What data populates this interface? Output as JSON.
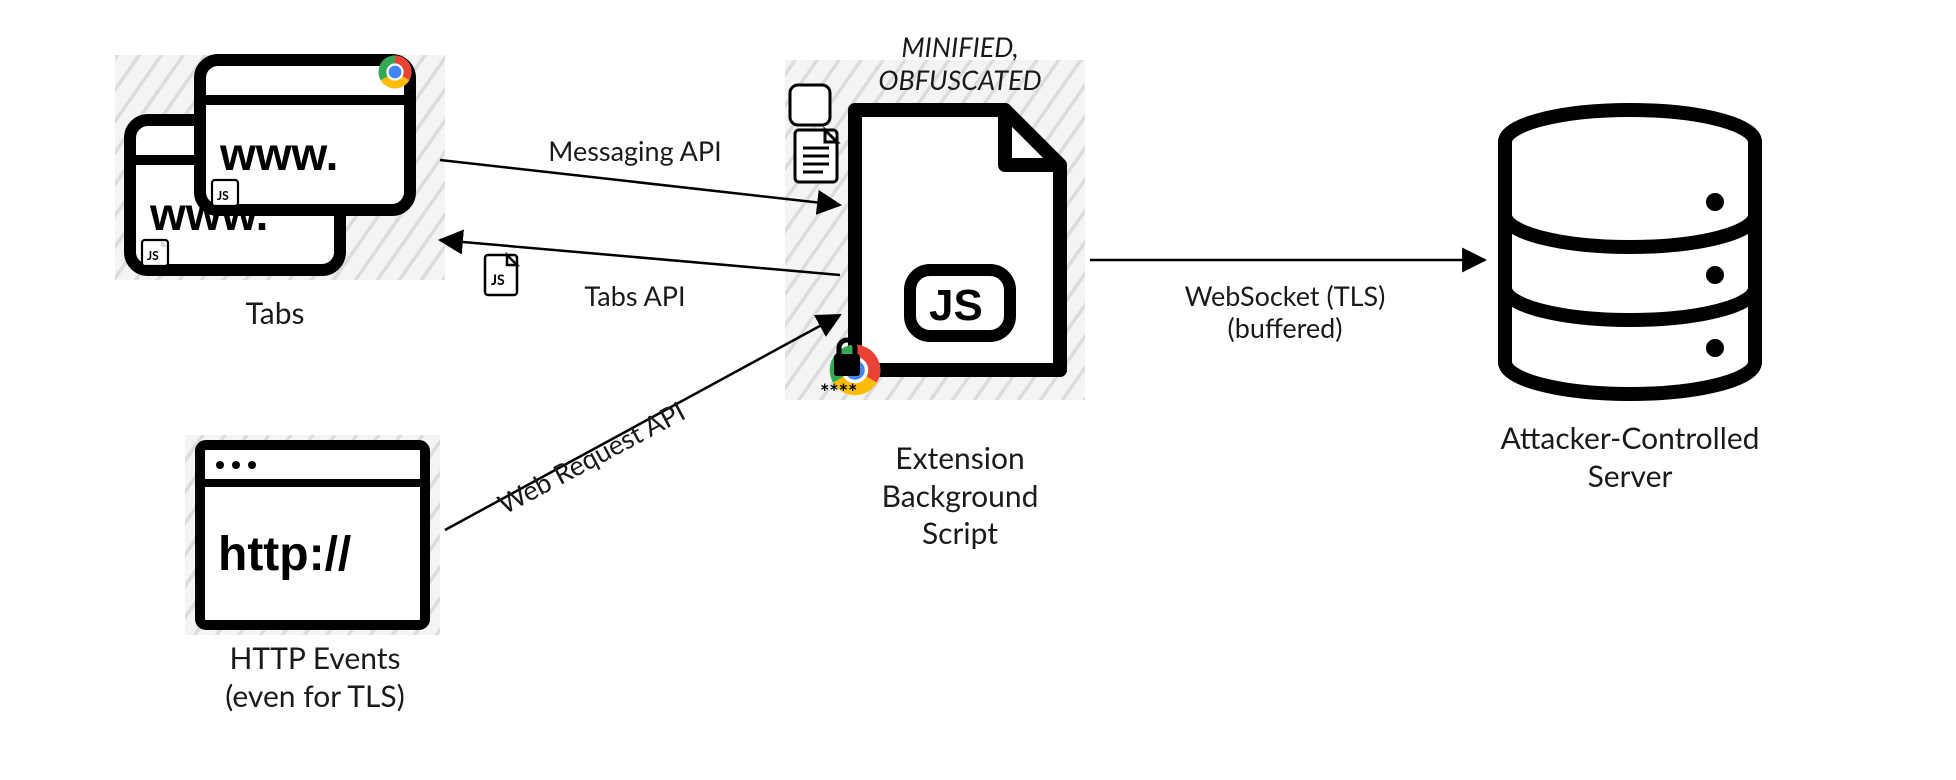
{
  "nodes": {
    "tabs": {
      "label": "Tabs",
      "windowText": "www."
    },
    "httpEvents": {
      "label": "HTTP Events\n(even for TLS)",
      "windowText": "http://"
    },
    "extScript": {
      "label": "Extension\nBackground\nScript",
      "badge": "JS",
      "annotation": "MINIFIED,\nOBFUSCATED"
    },
    "server": {
      "label": "Attacker-Controlled\nServer"
    }
  },
  "edges": {
    "messagingApi": {
      "label": "Messaging API"
    },
    "tabsApi": {
      "label": "Tabs API",
      "iconBadge": "JS"
    },
    "webRequestApi": {
      "label": "Web Request API",
      "lockPwd": "****"
    },
    "websocket": {
      "label": "WebSocket (TLS)\n(buffered)"
    }
  },
  "icons": {
    "chrome": "chrome-logo",
    "jsFile": "js-file-icon",
    "lock": "lock-icon",
    "document": "document-icon",
    "database": "database-icon"
  }
}
